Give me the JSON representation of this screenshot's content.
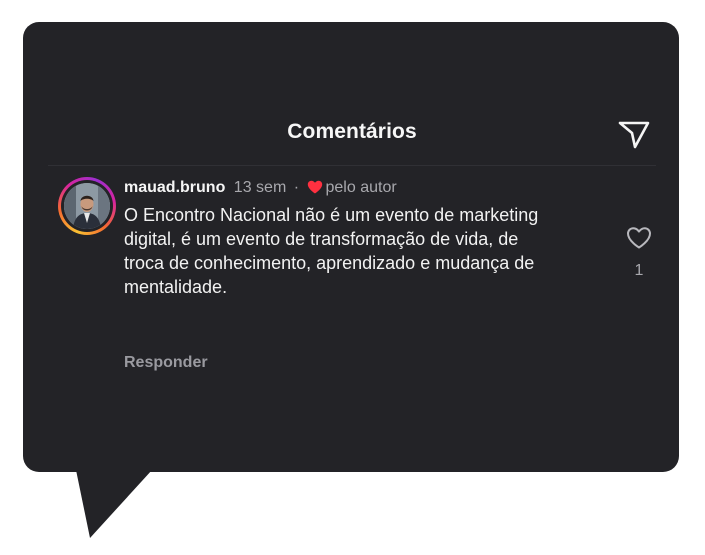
{
  "header": {
    "title": "Comentários"
  },
  "comment": {
    "username": "mauad.bruno",
    "time": "13 sem",
    "separator": "·",
    "author_label": "pelo autor",
    "text": "O Encontro Nacional não é um evento de marketing digital, é um evento de transformação de vida, de troca de conhecimento, aprendizado e mudança de mentalidade.",
    "reply_label": "Responder",
    "like_count": "1"
  },
  "icons": {
    "send": "send-icon",
    "like": "heart-outline-icon",
    "author_like": "heart-filled-icon"
  },
  "colors": {
    "background": "#232327",
    "heart": "#ff3040",
    "muted_text": "#a8a8ad"
  }
}
